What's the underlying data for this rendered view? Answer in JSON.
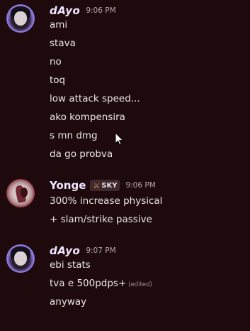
{
  "messages": [
    {
      "username": "dAyo",
      "timestamp": "9:06 PM",
      "lines": [
        "ami",
        "stava",
        "no",
        "toq",
        "low attack speed...",
        "ako kompensira",
        "s mn dmg",
        "da go probva"
      ]
    },
    {
      "username": "Yonge",
      "tag": "SKY",
      "tag_icon": "sword-icon",
      "timestamp": "9:06 PM",
      "lines": [
        "300% increase physical",
        "+ slam/strike passive"
      ]
    },
    {
      "username": "dAyo",
      "timestamp": "9:07 PM",
      "lines": [
        "ebi stats",
        "tva e 500pdps+",
        "anyway"
      ],
      "edited_label": "(edited)"
    }
  ],
  "colors": {
    "background": "#1e0a0d",
    "text": "#ece4e6",
    "timestamp": "#b3a6a9",
    "tag_bg": "#3e2a2e"
  }
}
